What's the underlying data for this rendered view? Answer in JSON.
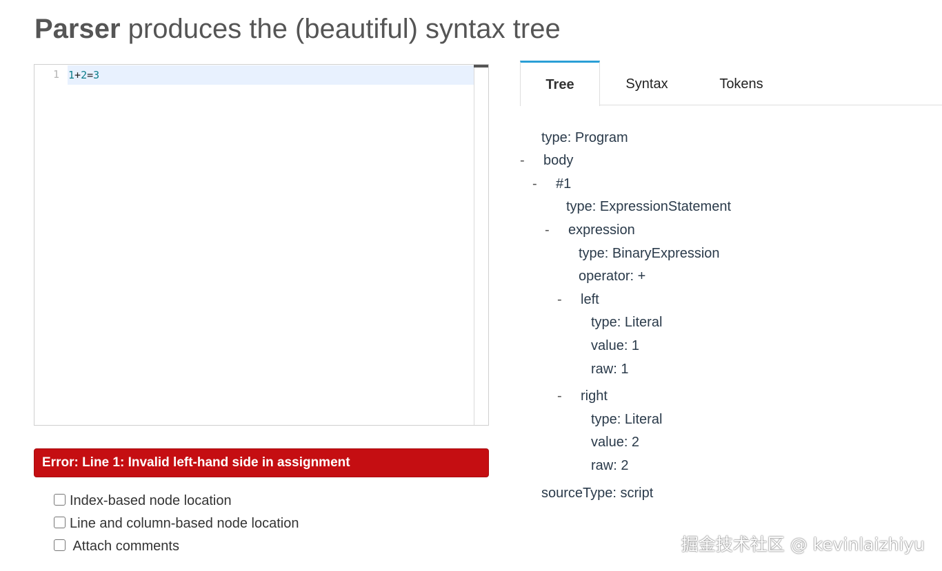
{
  "header": {
    "title_bold": "Parser",
    "title_rest": " produces the (beautiful) syntax tree"
  },
  "editor": {
    "line_number": "1",
    "code_tokens": [
      {
        "text": "1",
        "kind": "number"
      },
      {
        "text": "+",
        "kind": "operator"
      },
      {
        "text": "2",
        "kind": "number"
      },
      {
        "text": "=",
        "kind": "operator"
      },
      {
        "text": "3",
        "kind": "number"
      }
    ]
  },
  "error": {
    "message": "Error: Line 1: Invalid left-hand side in assignment"
  },
  "options": [
    {
      "label": "Index-based node location",
      "checked": false
    },
    {
      "label": "Line and column-based node location",
      "checked": false
    },
    {
      "label": " Attach comments",
      "checked": false
    }
  ],
  "tabs": [
    {
      "label": "Tree",
      "active": true
    },
    {
      "label": "Syntax",
      "active": false
    },
    {
      "label": "Tokens",
      "active": false
    }
  ],
  "tree": {
    "collapse_glyph": "-",
    "rows": [
      {
        "text": "type: Program"
      },
      {
        "text": "body",
        "collapsible": true
      },
      {
        "text": "#1",
        "collapsible": true
      },
      {
        "text": "type: ExpressionStatement"
      },
      {
        "text": "expression",
        "collapsible": true
      },
      {
        "text": "type: BinaryExpression"
      },
      {
        "text": "operator: +"
      },
      {
        "text": "left",
        "collapsible": true
      },
      {
        "text": "type: Literal"
      },
      {
        "text": "value: 1"
      },
      {
        "text": "raw: 1"
      },
      {
        "text": "right",
        "collapsible": true
      },
      {
        "text": "type: Literal"
      },
      {
        "text": "value: 2"
      },
      {
        "text": "raw: 2"
      },
      {
        "text": "sourceType: script"
      }
    ]
  },
  "watermark": "掘金技术社区 @ kevinlaizhiyu",
  "colors": {
    "tab_accent": "#2a9fd6",
    "error_bg": "#c50e12",
    "number_token": "#0c7d8a"
  }
}
